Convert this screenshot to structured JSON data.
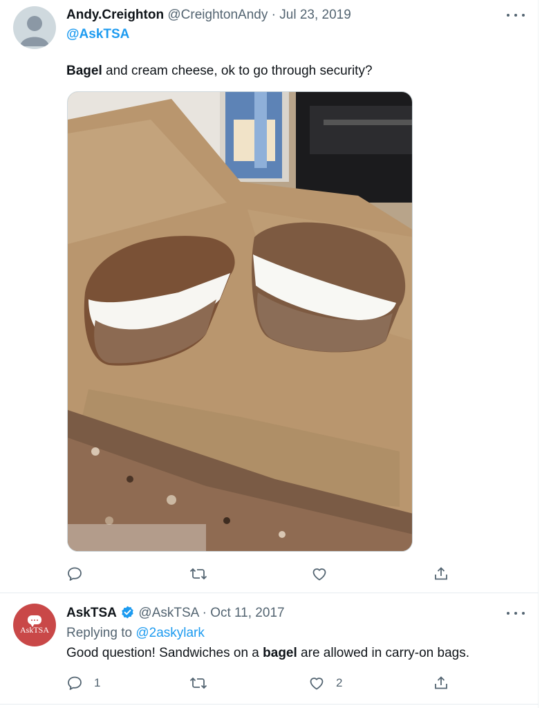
{
  "tweets": [
    {
      "author_name": "Andy.Creighton",
      "handle": "@CreightonAndy",
      "date": "Jul 23, 2019",
      "reply_to": "@AskTSA",
      "text_bold": "Bagel",
      "text_rest": " and cream cheese, ok to go through security?",
      "reply_count": "",
      "like_count": ""
    },
    {
      "author_name": "AskTSA",
      "avatar_text": "AskTSA",
      "verified": true,
      "handle": "@AskTSA",
      "date": "Oct 11, 2017",
      "replying_to_label": "Replying to ",
      "replying_to_handle": "@2askylark",
      "text_before": "Good question! Sandwiches on a ",
      "text_bold": "bagel",
      "text_after": " are allowed in carry-on bags.",
      "reply_count": "1",
      "like_count": "2"
    }
  ],
  "separator": " · ",
  "icons": [
    "more-icon",
    "reply-icon",
    "retweet-icon",
    "like-icon",
    "share-icon",
    "verified-badge-icon"
  ],
  "colors": {
    "link": "#1d9bf0",
    "secondary": "#536471",
    "avatar_tsa": "#c94848"
  }
}
